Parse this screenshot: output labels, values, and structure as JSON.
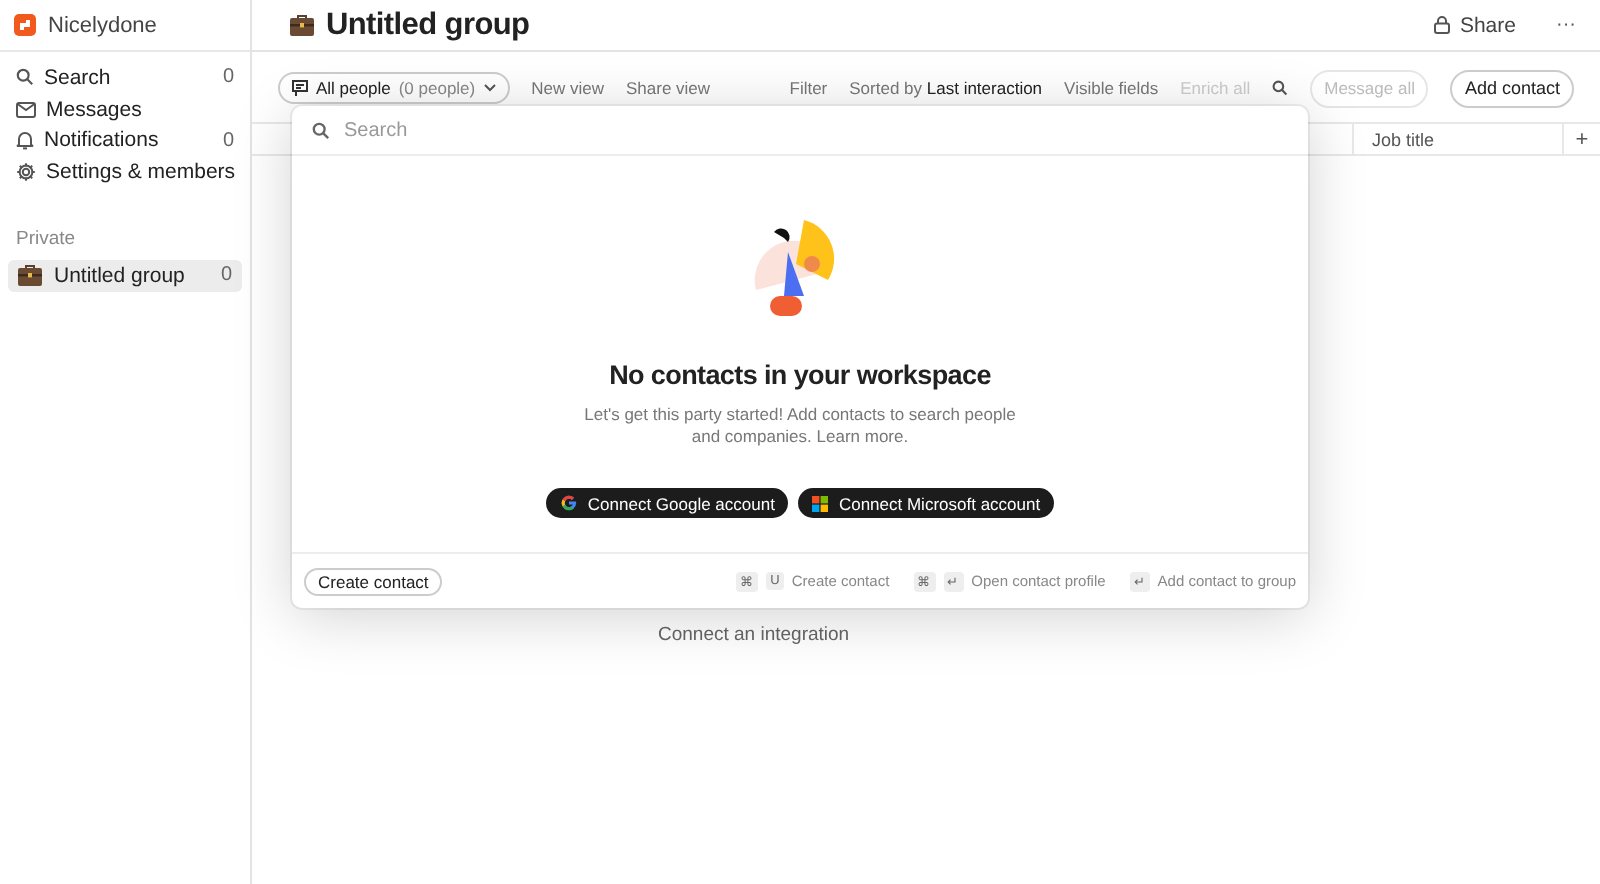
{
  "sidebar": {
    "workspace": "Nicelydone",
    "items": [
      {
        "label": "Search",
        "count": "0",
        "kind": "search"
      },
      {
        "label": "Messages",
        "kind": "mail"
      },
      {
        "label": "Notifications",
        "count": "0",
        "kind": "bell"
      },
      {
        "label": "Settings & members",
        "kind": "gear"
      }
    ],
    "section": "Private",
    "groups": [
      {
        "label": "Untitled group",
        "count": "0",
        "selected": true
      }
    ]
  },
  "header": {
    "title": "Untitled group",
    "share": "Share",
    "more": "···"
  },
  "toolbar": {
    "view": "All people",
    "view_count": "(0 people)",
    "links": [
      "New view",
      "Share view"
    ],
    "filter": "Filter",
    "sort": "Sorted by **Last interaction**",
    "visible_fields": "Visible fields",
    "enrich": {
      "label": "Enrich all",
      "disabled": true
    },
    "message_all": {
      "label": "Message all",
      "disabled": true
    },
    "add": "Add contact"
  },
  "table": {
    "columns": [
      "Job title"
    ],
    "add": "+"
  },
  "behind_link": "Connect an integration",
  "modal": {
    "placeholder": "Search",
    "title": "No contacts in your workspace",
    "text": "Let's get this party started! Add contacts to search people and companies. Learn more.",
    "buttons": [
      {
        "label": "Connect Google account",
        "kind": "google"
      },
      {
        "label": "Connect Microsoft account",
        "kind": "microsoft"
      }
    ],
    "create": "Create contact",
    "shortcuts": [
      {
        "keys": [
          "⌘",
          "U"
        ],
        "label": "Create contact"
      },
      {
        "keys": [
          "⌘",
          "↵"
        ],
        "label": "Open contact profile"
      },
      {
        "keys": [
          "↵"
        ],
        "label": "Add contact to group"
      }
    ]
  }
}
